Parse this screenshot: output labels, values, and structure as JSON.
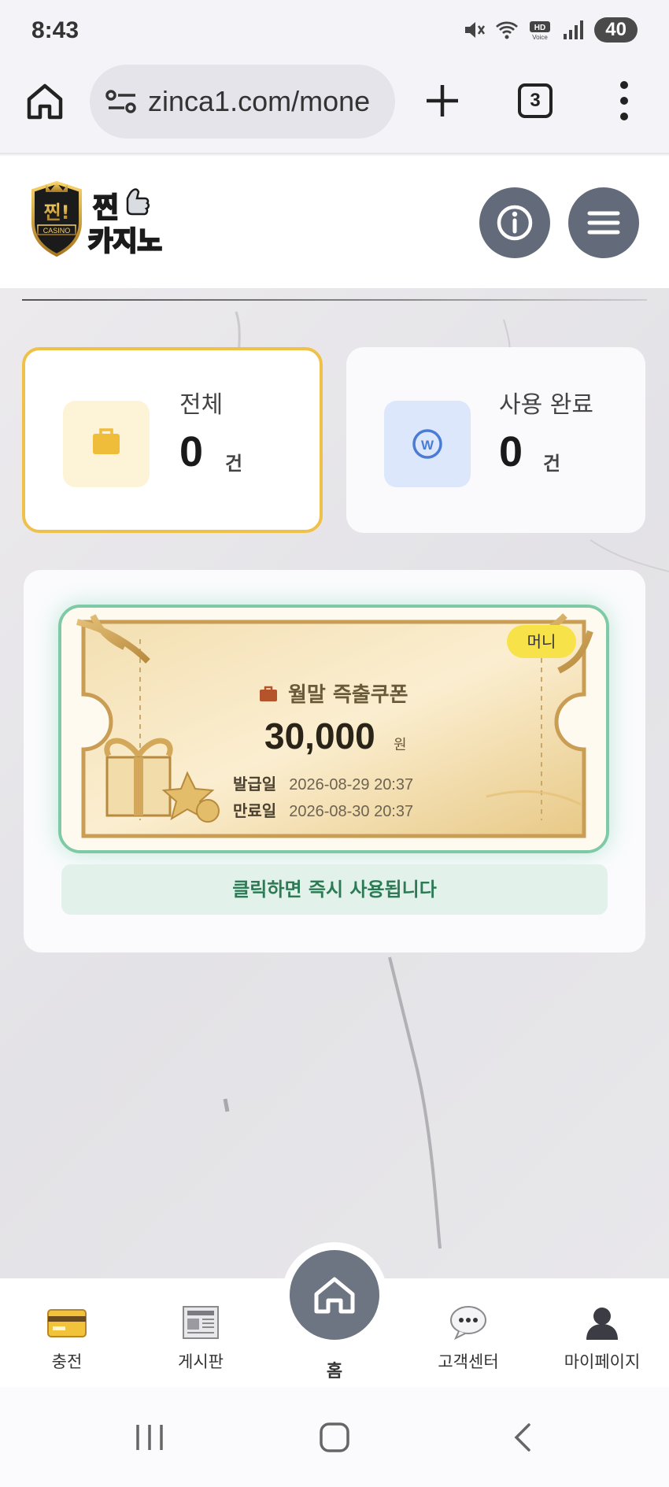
{
  "status_bar": {
    "time": "8:43",
    "battery": "40"
  },
  "browser": {
    "url": "zinca1.com/mone",
    "tab_count": "3"
  },
  "site": {
    "logo_text_top": "찐!",
    "logo_text_main": "찐카지노",
    "logo_casino": "CASINO"
  },
  "stats": {
    "all": {
      "label": "전체",
      "value": "0",
      "unit": "건",
      "accent": "#f0c14a"
    },
    "used": {
      "label": "사용 완료",
      "value": "0",
      "unit": "건",
      "icon_letter": "W"
    }
  },
  "coupon": {
    "badge": "머니",
    "title": "월말 즉출쿠폰",
    "amount": "30,000",
    "currency": "원",
    "issue_label": "발급일",
    "issue_date": "2026-08-29 20:37",
    "expire_label": "만료일",
    "expire_date": "2026-08-30 20:37",
    "use_hint": "클릭하면 즉시 사용됩니다"
  },
  "bottom_nav": {
    "charge": "충전",
    "board": "게시판",
    "home": "홈",
    "support": "고객센터",
    "mypage": "마이페이지"
  },
  "colors": {
    "header_button": "#636b7a",
    "coupon_border": "#7fcaa6",
    "use_text": "#2d7a55"
  }
}
